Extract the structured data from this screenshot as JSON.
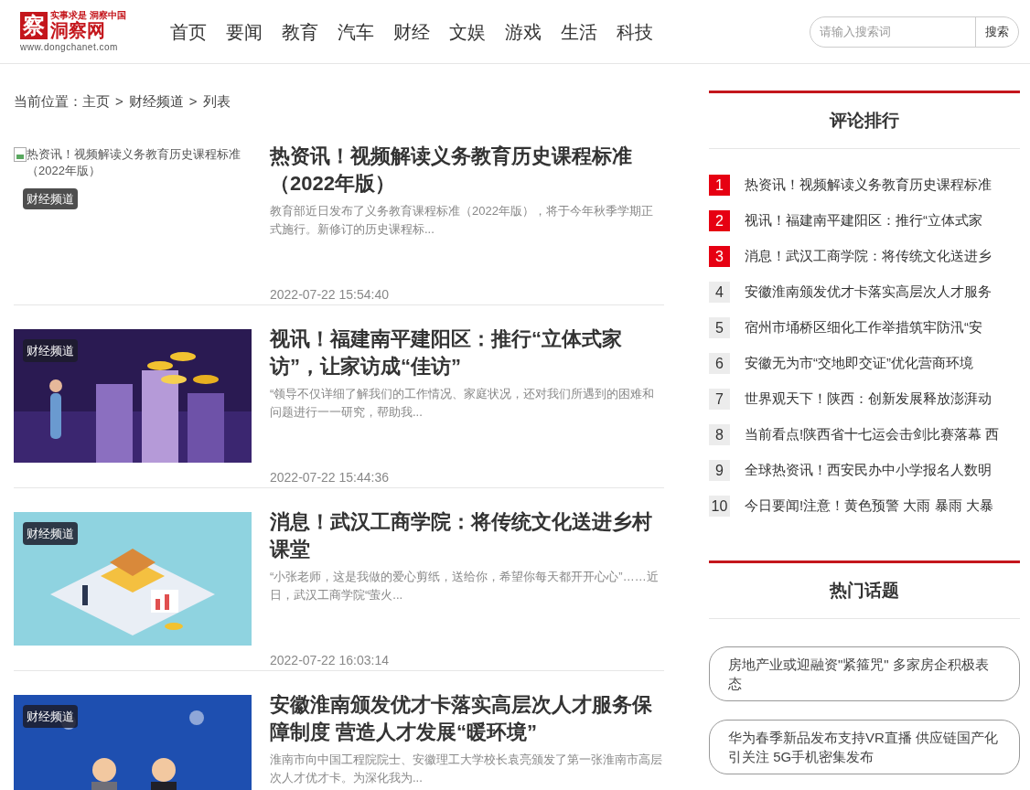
{
  "logo": {
    "mark": "察",
    "name": "洞察网",
    "slogan": "实事求是 洞察中国",
    "url": "www.dongchanet.com"
  },
  "nav": [
    {
      "label": "首页"
    },
    {
      "label": "要闻"
    },
    {
      "label": "教育"
    },
    {
      "label": "汽车"
    },
    {
      "label": "财经"
    },
    {
      "label": "文娱"
    },
    {
      "label": "游戏"
    },
    {
      "label": "生活"
    },
    {
      "label": "科技"
    }
  ],
  "search": {
    "placeholder": "请输入搜索词",
    "button": "搜索"
  },
  "breadcrumb": [
    {
      "kind": "label",
      "text": "当前位置："
    },
    {
      "kind": "link",
      "text": "主页"
    },
    {
      "kind": "sep",
      "text": ">"
    },
    {
      "kind": "link",
      "text": "财经频道"
    },
    {
      "kind": "sep",
      "text": ">"
    },
    {
      "kind": "link",
      "text": "列表"
    }
  ],
  "articles": [
    {
      "image": {
        "kind": "broken",
        "alt": "热资讯！视频解读义务教育历史课程标准（2022年版）"
      },
      "tag": "财经频道",
      "title": "热资讯！视频解读义务教育历史课程标准（2022年版）",
      "excerpt": "教育部近日发布了义务教育课程标准（2022年版），将于今年秋季学期正式施行。新修订的历史课程标...",
      "date": "2022-07-22 15:54:40"
    },
    {
      "image": {
        "kind": "coins"
      },
      "tag": "财经频道",
      "title": "视讯！福建南平建阳区：推行“立体式家访”，让家访成“佳访”",
      "excerpt": "“领导不仅详细了解我们的工作情况、家庭状况，还对我们所遇到的困难和问题进行一一研究，帮助我...",
      "date": "2022-07-22 15:44:36"
    },
    {
      "image": {
        "kind": "isometric"
      },
      "tag": "财经频道",
      "title": "消息！武汉工商学院：将传统文化送进乡村课堂",
      "excerpt": "“小张老师，这是我做的爱心剪纸，送给你，希望你每天都开开心心”……近日，武汉工商学院“萤火...",
      "date": "2022-07-22 16:03:14"
    },
    {
      "image": {
        "kind": "handshake"
      },
      "tag": "财经频道",
      "title": "安徽淮南颁发优才卡落实高层次人才服务保障制度 营造人才发展“暖环境”",
      "excerpt": "淮南市向中国工程院院士、安徽理工大学校长袁亮颁发了第一张淮南市高层次人才优才卡。为深化我为..."
    }
  ],
  "ranking": {
    "title": "评论排行",
    "items": [
      {
        "rank": "1",
        "hot": true,
        "text": "热资讯！视频解读义务教育历史课程标准"
      },
      {
        "rank": "2",
        "hot": true,
        "text": "视讯！福建南平建阳区：推行“立体式家"
      },
      {
        "rank": "3",
        "hot": true,
        "text": "消息！武汉工商学院：将传统文化送进乡"
      },
      {
        "rank": "4",
        "hot": false,
        "text": "安徽淮南颁发优才卡落实高层次人才服务"
      },
      {
        "rank": "5",
        "hot": false,
        "text": "宿州市埇桥区细化工作举措筑牢防汛“安"
      },
      {
        "rank": "6",
        "hot": false,
        "text": "安徽无为市“交地即交证”优化营商环境"
      },
      {
        "rank": "7",
        "hot": false,
        "text": "世界观天下！陕西：创新发展释放澎湃动"
      },
      {
        "rank": "8",
        "hot": false,
        "text": "当前看点!陕西省十七运会击剑比赛落幕 西"
      },
      {
        "rank": "9",
        "hot": false,
        "text": "全球热资讯！西安民办中小学报名人数明"
      },
      {
        "rank": "10",
        "hot": false,
        "text": "今日要闻!注意！黄色预警 大雨 暴雨 大暴"
      }
    ]
  },
  "topics": {
    "title": "热门话题",
    "items": [
      "房地产业或迎融资\"紧箍咒\" 多家房企积极表态",
      "华为春季新品发布支持VR直播 供应链国产化引关注 5G手机密集发布"
    ]
  }
}
